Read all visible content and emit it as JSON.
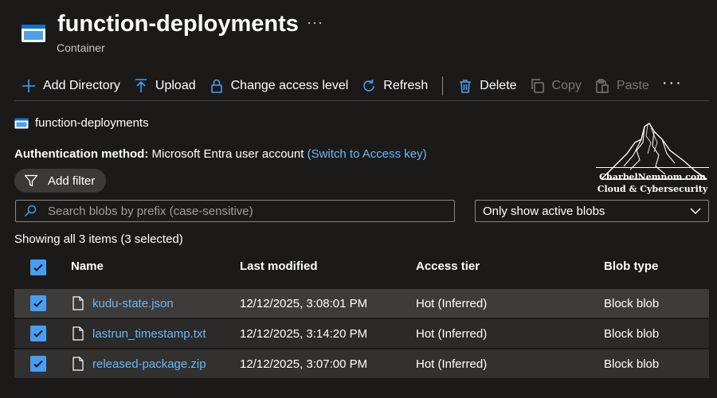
{
  "header": {
    "title": "function-deployments",
    "more": "···",
    "subtitle": "Container"
  },
  "toolbar": {
    "add_directory": "Add Directory",
    "upload": "Upload",
    "change_access": "Change access level",
    "refresh": "Refresh",
    "delete": "Delete",
    "copy": "Copy",
    "paste": "Paste",
    "more": "···"
  },
  "breadcrumb": {
    "label": "function-deployments"
  },
  "auth": {
    "label": "Authentication method:",
    "value": "Microsoft Entra user account",
    "switch_link": "(Switch to Access key)"
  },
  "filter": {
    "label": "Add filter"
  },
  "search": {
    "placeholder": "Search blobs by prefix (case-sensitive)"
  },
  "blob_filter": {
    "selected": "Only show active blobs"
  },
  "status": {
    "count_text": "Showing all 3 items (3 selected)"
  },
  "table": {
    "columns": [
      "Name",
      "Last modified",
      "Access tier",
      "Blob type"
    ],
    "rows": [
      {
        "name": "kudu-state.json",
        "modified": "12/12/2025, 3:08:01 PM",
        "tier": "Hot (Inferred)",
        "type": "Block blob",
        "selected": true
      },
      {
        "name": "lastrun_timestamp.txt",
        "modified": "12/12/2025, 3:14:20 PM",
        "tier": "Hot (Inferred)",
        "type": "Block blob",
        "selected": true
      },
      {
        "name": "released-package.zip",
        "modified": "12/12/2025, 3:07:00 PM",
        "tier": "Hot (Inferred)",
        "type": "Block blob",
        "selected": true
      }
    ]
  },
  "watermark": {
    "line1": "CharbelNemnom.com",
    "line2": "Cloud & Cybersecurity"
  },
  "icons": {
    "container": "container-icon",
    "add": "plus-icon",
    "upload": "upload-icon",
    "lock": "lock-icon",
    "refresh": "refresh-icon",
    "delete": "trash-icon",
    "copy": "copy-icon",
    "paste": "paste-icon",
    "filter": "funnel-icon",
    "search": "search-icon",
    "chevron": "chevron-down-icon",
    "file": "file-icon",
    "check": "checkmark-icon"
  },
  "colors": {
    "background": "#1b1a19",
    "link": "#6cb8f6",
    "accent": "#479ef5"
  }
}
